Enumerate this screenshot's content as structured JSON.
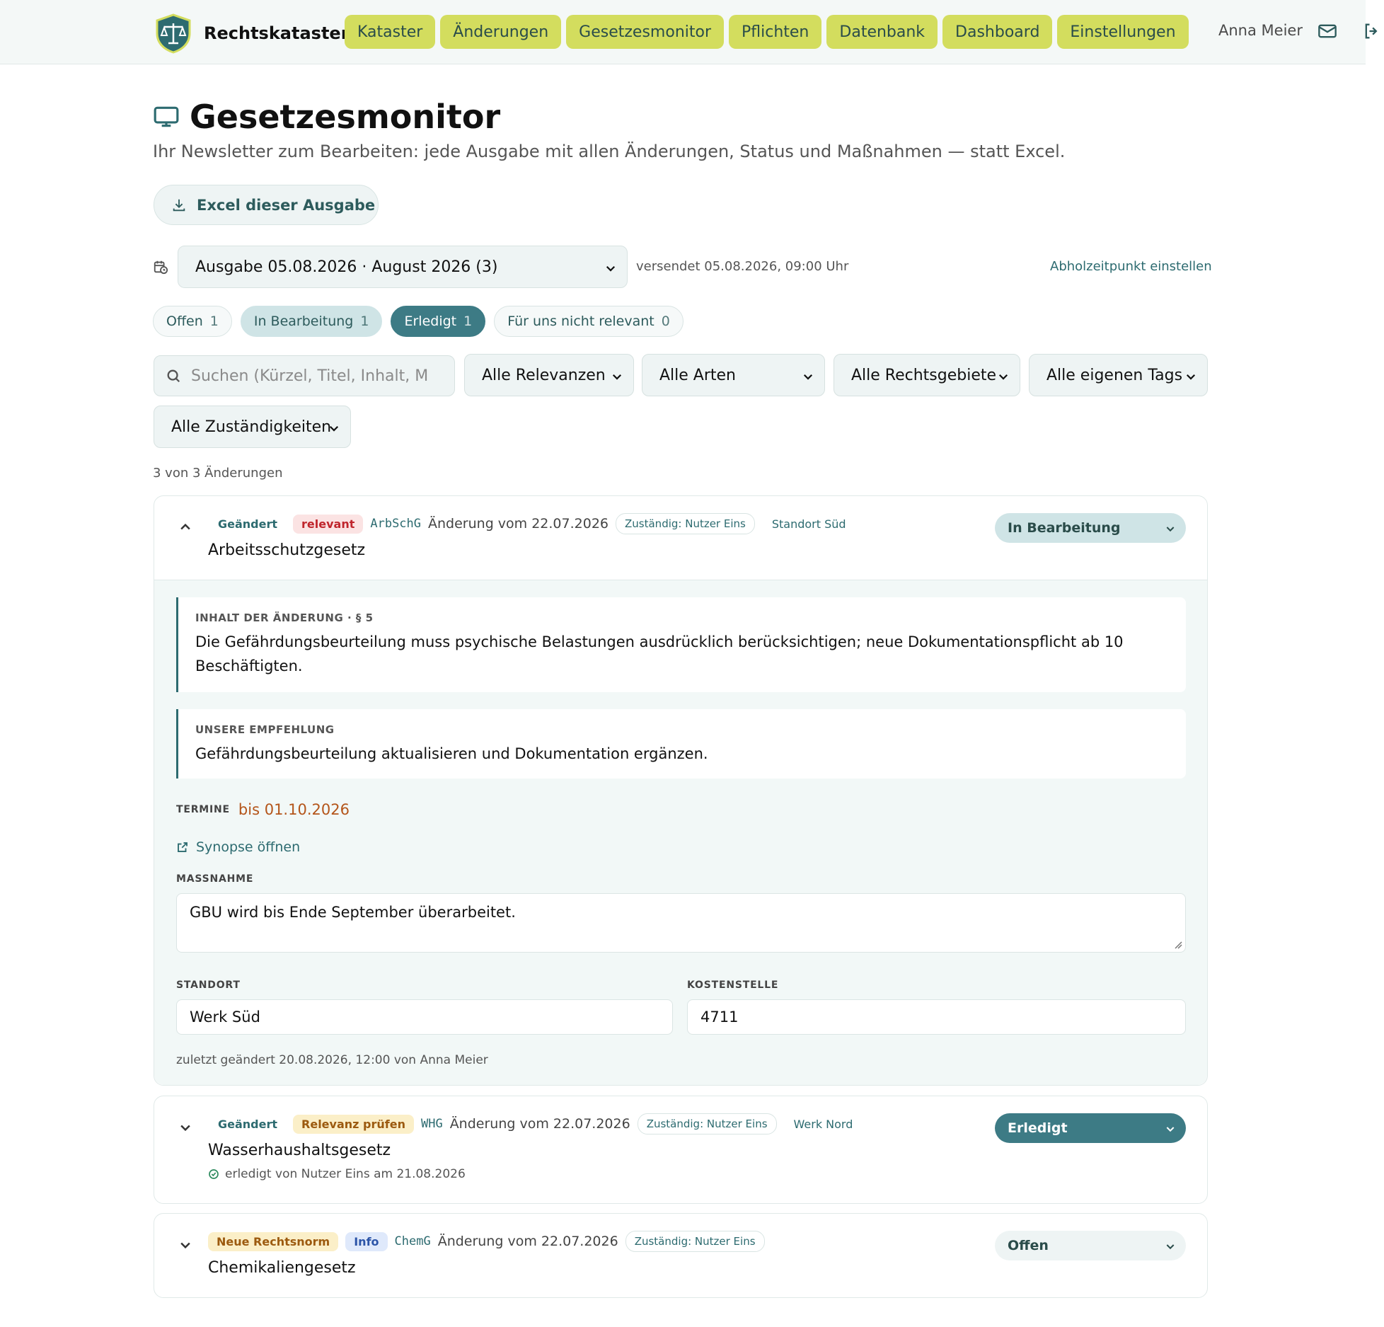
{
  "brand": {
    "name": "Rechtskataster",
    "logo": "shield-scales-logo"
  },
  "nav": [
    "Kataster",
    "Änderungen",
    "Gesetzesmonitor",
    "Pflichten",
    "Datenbank",
    "Dashboard",
    "Einstellungen"
  ],
  "user": {
    "name": "Anna Meier"
  },
  "header": {
    "title": "Gesetzesmonitor",
    "subtitle": "Ihr Newsletter zum Bearbeiten: jede Ausgabe mit allen Änderungen, Status und Maßnahmen — statt Excel.",
    "excel_button": "Excel dieser Ausgabe"
  },
  "issue": {
    "selected": "Ausgabe 05.08.2026 · August 2026 (3)",
    "sent": "versendet 05.08.2026, 09:00 Uhr",
    "pickup_link": "Abholzeitpunkt einstellen"
  },
  "status_pills": [
    {
      "label": "Offen",
      "count": "1"
    },
    {
      "label": "In Bearbeitung",
      "count": "1"
    },
    {
      "label": "Erledigt",
      "count": "1"
    },
    {
      "label": "Für uns nicht relevant",
      "count": "0"
    }
  ],
  "filters": {
    "search_placeholder": "Suchen (Kürzel, Titel, Inhalt, Maßnahme)",
    "relevance": "Alle Relevanzen",
    "type": "Alle Arten",
    "area": "Alle Rechtsgebiete",
    "tags": "Alle eigenen Tags",
    "responsibility": "Alle Zuständigkeiten"
  },
  "count_line": "3 von 3 Änderungen",
  "cards": [
    {
      "kind": "Geändert",
      "relevance": "relevant",
      "code": "ArbSchG",
      "date": "Änderung vom 22.07.2026",
      "owner": "Zuständig: Nutzer Eins",
      "site": "Standort Süd",
      "law": "Arbeitsschutzgesetz",
      "status": "In Bearbeitung",
      "content_label": "INHALT DER ÄNDERUNG · § 5",
      "content_text": "Die Gefährdungsbeurteilung muss psychische Belastungen ausdrücklich berücksichtigen; neue Dokumentationspflicht ab 10 Beschäftigten.",
      "recommendation_label": "UNSERE EMPFEHLUNG",
      "recommendation_text": "Gefährdungsbeurteilung aktualisieren und Dokumentation ergänzen.",
      "termine_label": "TERMINE",
      "deadline": "bis 01.10.2026",
      "synopse": "Synopse öffnen",
      "massnahme_label": "MASSNAHME",
      "massnahme": "GBU wird bis Ende September überarbeitet.",
      "standort_label": "STANDORT",
      "standort": "Werk Süd",
      "kostenstelle_label": "KOSTENSTELLE",
      "kostenstelle": "4711",
      "modified": "zuletzt geändert 20.08.2026, 12:00 von Anna Meier"
    },
    {
      "kind": "Geändert",
      "relevance": "Relevanz prüfen",
      "code": "WHG",
      "date": "Änderung vom 22.07.2026",
      "owner": "Zuständig: Nutzer Eins",
      "site": "Werk Nord",
      "law": "Wasserhaushaltsgesetz",
      "status": "Erledigt",
      "done_note": "erledigt von Nutzer Eins am 21.08.2026"
    },
    {
      "kind": "Neue Rechtsnorm",
      "relevance": "Info",
      "code": "ChemG",
      "date": "Änderung vom 22.07.2026",
      "owner": "Zuständig: Nutzer Eins",
      "law": "Chemikaliengesetz",
      "status": "Offen"
    }
  ],
  "colors": {
    "nav_bg": "#d3dd5e",
    "accent": "#3d7b85",
    "relevant": "#c0262d",
    "deadline": "#b4551a"
  }
}
